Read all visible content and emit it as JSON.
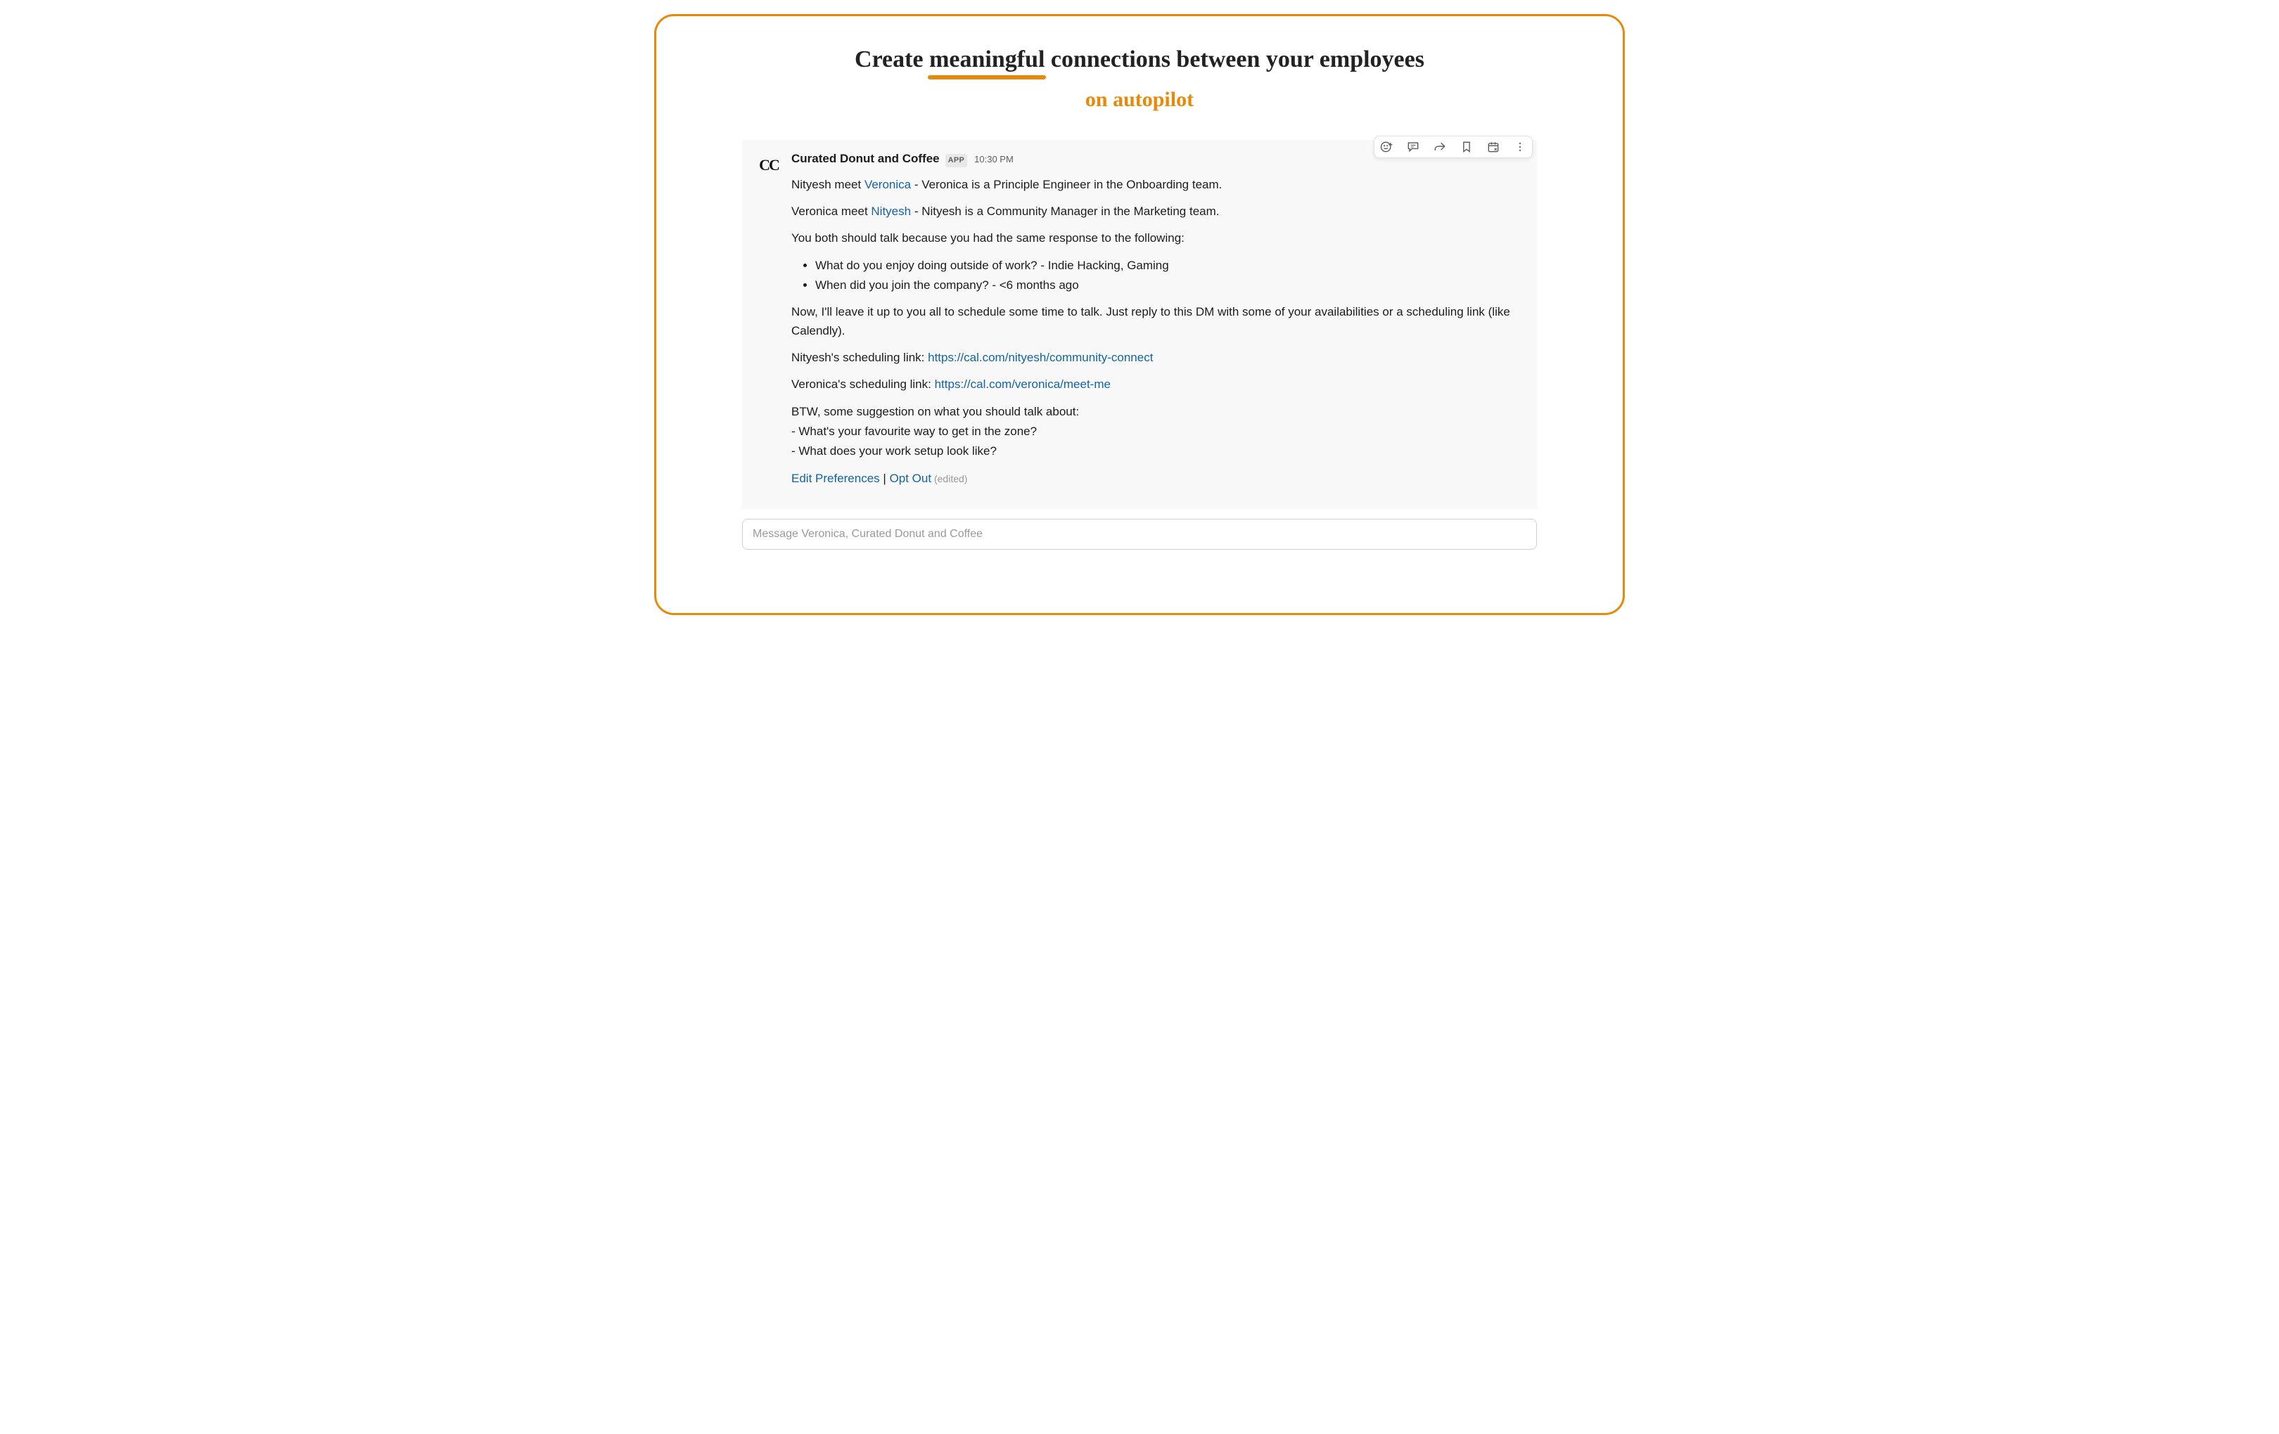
{
  "hero": {
    "line1_pre": "Create ",
    "line1_underlined": "meaningful",
    "line1_post": " connections between your employees",
    "line2": "on autopilot"
  },
  "message": {
    "avatar_text": "CC",
    "sender": "Curated Donut and Coffee",
    "app_badge": "APP",
    "timestamp": "10:30 PM",
    "intro1_pre": "Nityesh meet ",
    "intro1_mention": "Veronica",
    "intro1_post": " - Veronica is a Principle Engineer in the Onboarding team.",
    "intro2_pre": "Veronica meet ",
    "intro2_mention": "Nityesh",
    "intro2_post": " - Nityesh is a Community Manager in the Marketing team.",
    "reason_lead": "You both should talk because you had the same response to the following:",
    "reasons": [
      "What do you enjoy doing outside of work? - Indie Hacking, Gaming",
      "When did you join the company? - <6 months ago"
    ],
    "schedule_prompt": "Now, I'll leave it up to you all to schedule some time to talk. Just reply to this DM with some of your availabilities or a scheduling link (like Calendly).",
    "link1_label": "Nityesh's scheduling link: ",
    "link1_url": "https://cal.com/nityesh/community-connect",
    "link2_label": "Veronica's scheduling link: ",
    "link2_url": "https://cal.com/veronica/meet-me",
    "suggestion_lead": "BTW, some suggestion on what you should talk about:",
    "suggestion1": "- What's your favourite way to get in the zone?",
    "suggestion2": "- What does your work setup look like?",
    "edit_prefs": "Edit Preferences",
    "pipe": " | ",
    "opt_out": "Opt Out",
    "edited": " (edited)"
  },
  "hover_actions": {
    "react": "add-reaction",
    "thread": "reply-thread",
    "share": "share",
    "bookmark": "bookmark",
    "remind": "create-reminder",
    "more": "more-actions"
  },
  "composer": {
    "placeholder": "Message Veronica, Curated Donut and Coffee"
  }
}
